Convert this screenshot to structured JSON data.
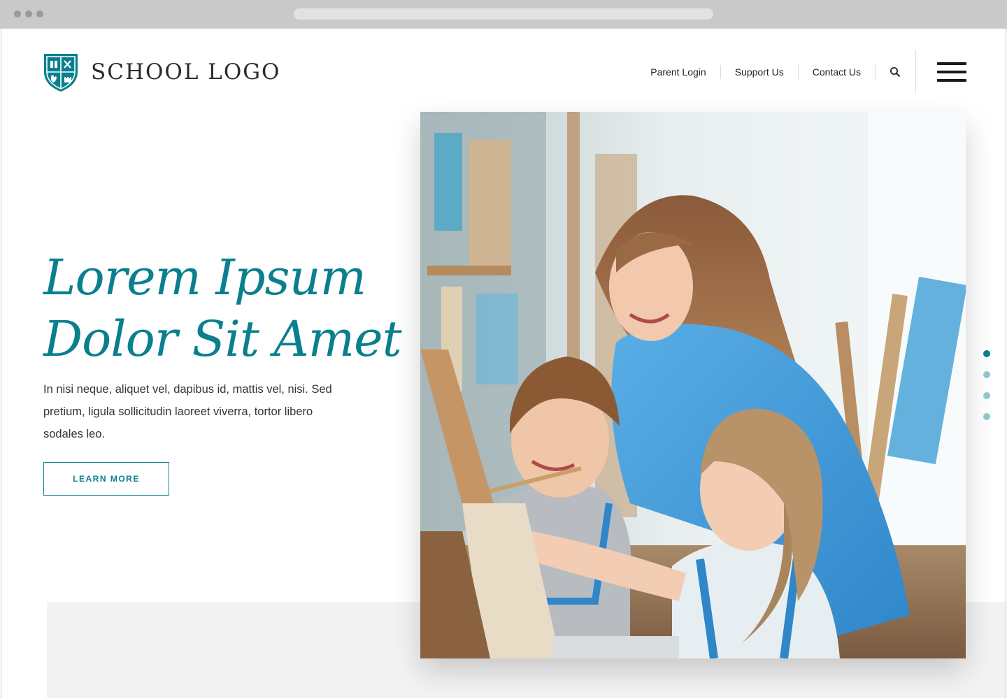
{
  "logo": {
    "text": "SCHOOL LOGO",
    "icon": "shield-crest-icon"
  },
  "nav": {
    "items": [
      {
        "label": "Parent Login"
      },
      {
        "label": "Support Us"
      },
      {
        "label": "Contact Us"
      }
    ],
    "search_icon": "search-icon",
    "menu_icon": "hamburger-menu-icon"
  },
  "hero": {
    "title_line1": "Lorem Ipsum",
    "title_line2": "Dolor Sit Amet",
    "body": "In nisi neque, aliquet vel, dapibus id, mattis vel, nisi. Sed pretium, ligula sollicitudin laoreet viverra, tortor libero sodales leo.",
    "cta_label": "LEARN MORE"
  },
  "slider": {
    "count": 4,
    "active_index": 0
  },
  "colors": {
    "accent": "#0a7f8e",
    "accent_light": "#8fc6cc",
    "text": "#333333",
    "band": "#f3f3f3"
  }
}
